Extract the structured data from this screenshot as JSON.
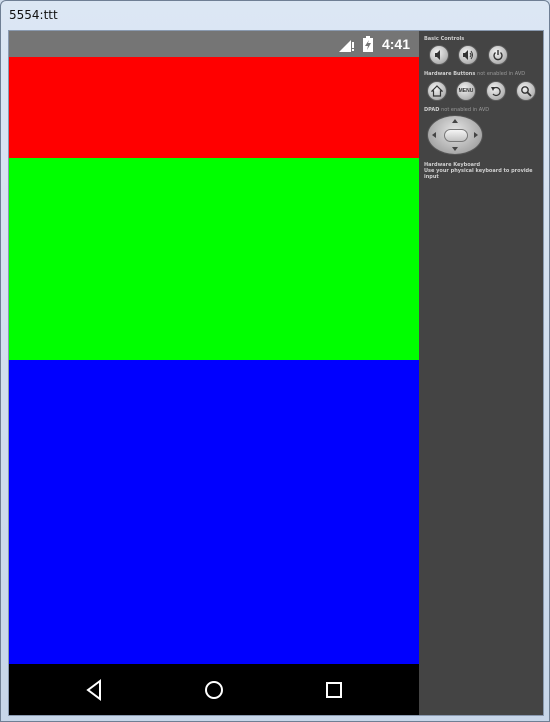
{
  "window": {
    "title": "5554:ttt"
  },
  "status_bar": {
    "time": "4:41"
  },
  "content_bands": [
    {
      "color": "#ff0000"
    },
    {
      "color": "#00ff00"
    },
    {
      "color": "#0000ff"
    }
  ],
  "nav_bar": {
    "back_icon": "back-triangle",
    "home_icon": "home-circle",
    "recents_icon": "recents-square"
  },
  "controls_panel": {
    "basic_controls_label": "Basic Controls",
    "hardware_buttons_label": "Hardware Buttons",
    "hardware_buttons_note": "not enabled in AVD",
    "menu_label": "MENU",
    "dpad_label": "DPAD",
    "dpad_note": "not enabled in AVD",
    "keyboard_label": "Hardware Keyboard",
    "keyboard_note": "Use your physical keyboard to provide input"
  }
}
